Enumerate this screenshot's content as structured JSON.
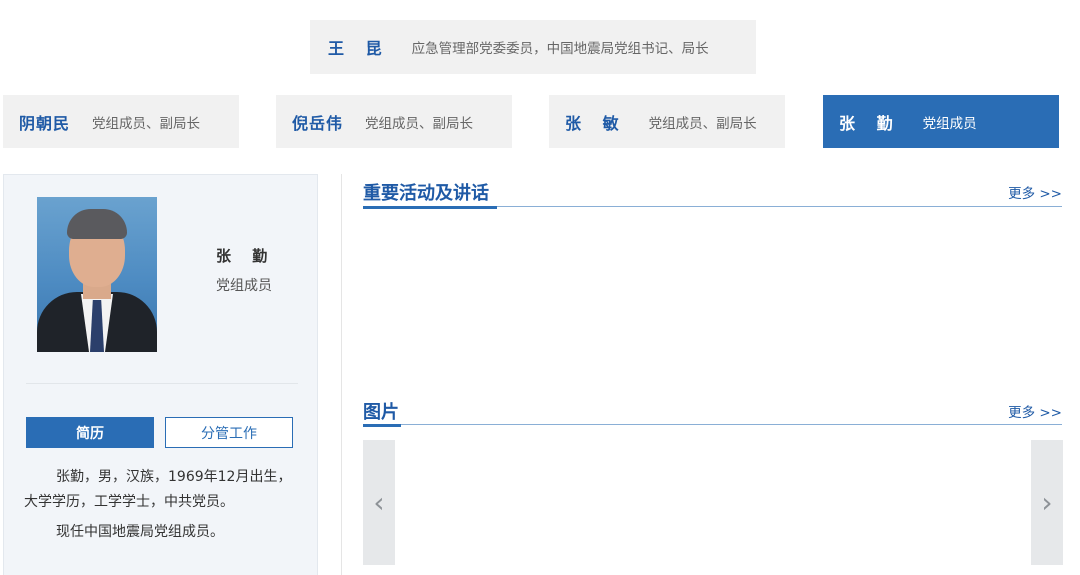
{
  "top_leader": {
    "name": "王 昆",
    "role": "应急管理部党委委员，中国地震局党组书记、局长"
  },
  "members": [
    {
      "name": "阴朝民",
      "role": "党组成员、副局长"
    },
    {
      "name": "倪岳伟",
      "role": "党组成员、副局长"
    },
    {
      "name": "张 敏",
      "role": "党组成员、副局长"
    },
    {
      "name": "张 勤",
      "role": "党组成员"
    }
  ],
  "profile": {
    "name": "张 勤",
    "role": "党组成员",
    "tabs": [
      "简历",
      "分管工作"
    ],
    "bio": [
      "张勤，男，汉族，1969年12月出生，大学学历，工学学士，中共党员。",
      "现任中国地震局党组成员。"
    ]
  },
  "sections": [
    {
      "title": "重要活动及讲话",
      "more": "更多 >>"
    },
    {
      "title": "图片",
      "more": "更多 >>"
    }
  ],
  "carousel": {
    "prev_icon": "chevron-left-icon",
    "next_icon": "chevron-right-icon",
    "prev_glyph": "‹",
    "next_glyph": "›"
  },
  "colors": {
    "accent": "#2a6db5",
    "name_blue": "#1f5aa6",
    "card_bg": "#f1f1f1",
    "panel_bg": "#f2f5f9"
  }
}
